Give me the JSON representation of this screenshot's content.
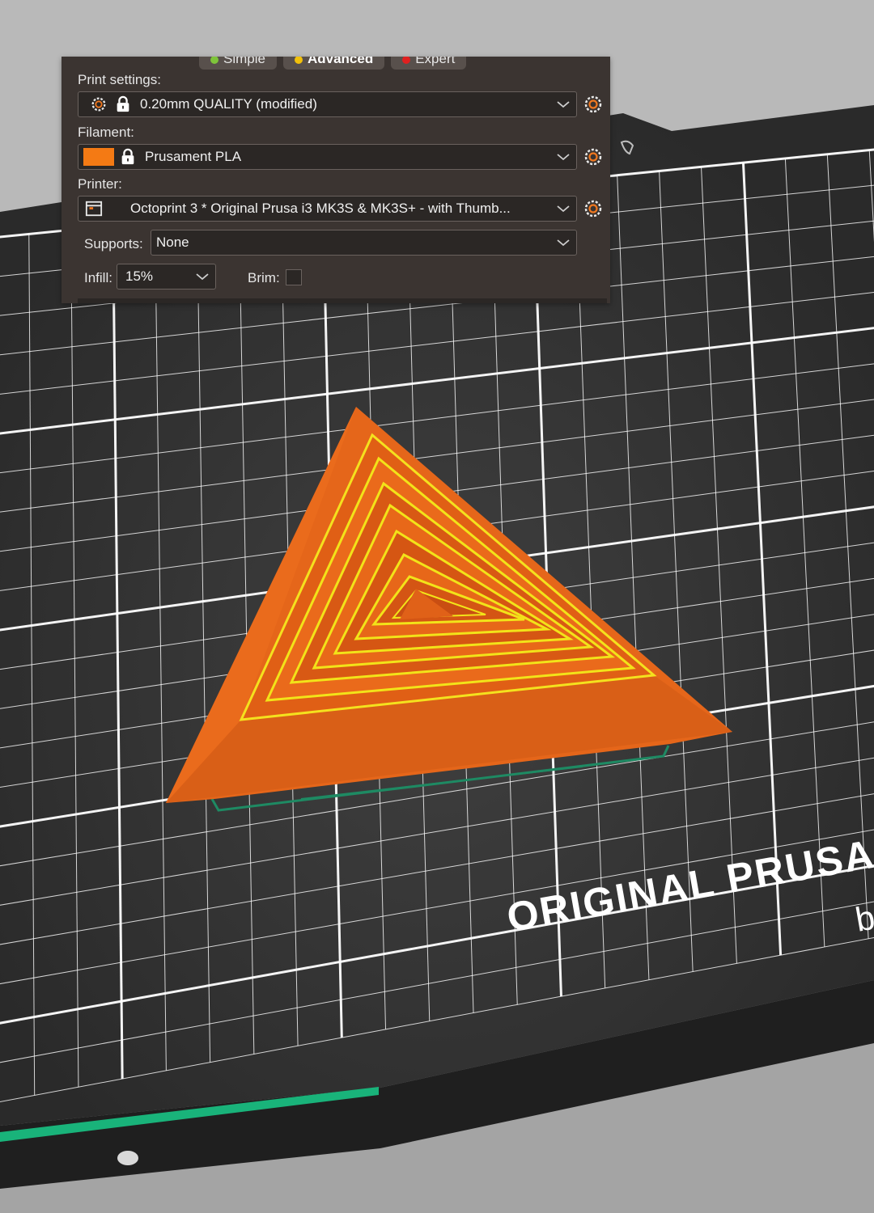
{
  "mode_tabs": [
    {
      "label": "Simple",
      "color": "#7ec43a"
    },
    {
      "label": "Advanced",
      "color": "#f2c10b"
    },
    {
      "label": "Expert",
      "color": "#e02020"
    }
  ],
  "print_settings": {
    "label": "Print settings:",
    "value": "0.20mm QUALITY (modified)"
  },
  "filament": {
    "label": "Filament:",
    "value": "Prusament PLA",
    "color": "#f47a14"
  },
  "printer": {
    "label": "Printer:",
    "value": "Octoprint 3 * Original Prusa i3 MK3S & MK3S+ - with Thumb..."
  },
  "supports": {
    "label": "Supports:",
    "value": "None"
  },
  "infill": {
    "label": "Infill:",
    "value": "15%"
  },
  "brim": {
    "label": "Brim:",
    "checked": false
  },
  "bed": {
    "brand_text": "ORIGINAL PRUSA",
    "brand_sub": "b"
  },
  "colors": {
    "accent": "#ed6b21",
    "model_highlight": "#e8e21a",
    "bed": "#2f2f2f",
    "grid": "#ffffff",
    "panel": "#3b3431"
  },
  "icons": [
    "gear-icon",
    "lock-icon",
    "printer-icon",
    "chevron-down-icon"
  ]
}
